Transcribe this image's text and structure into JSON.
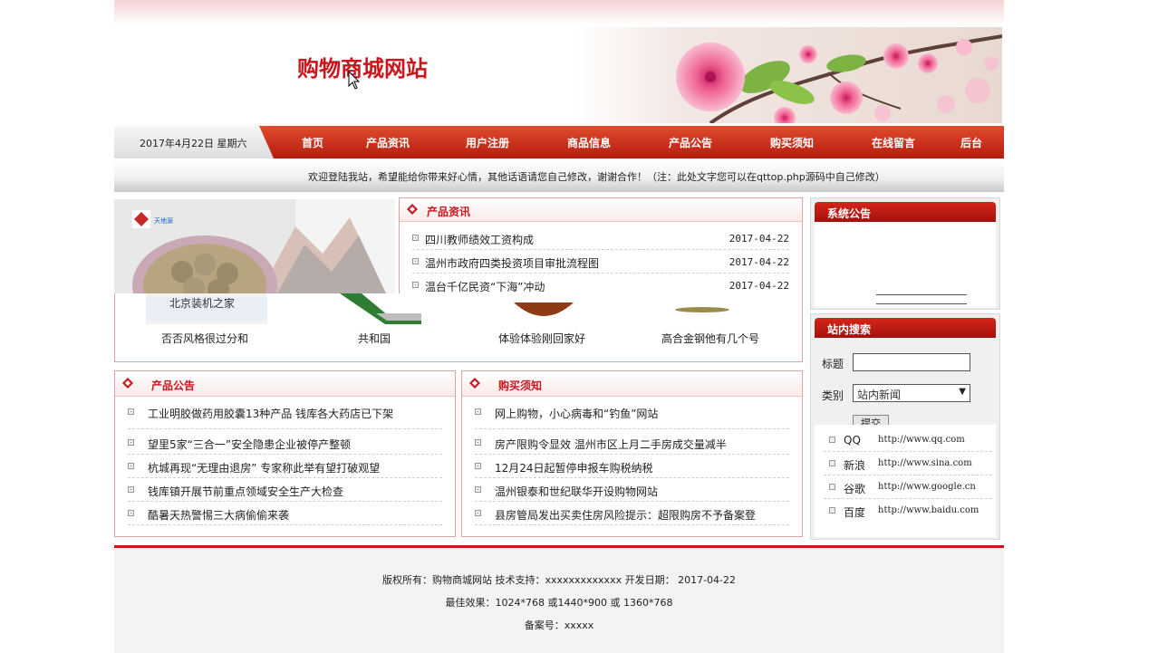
{
  "header": {
    "title": "购物商城网站"
  },
  "nav": {
    "date": "2017年4月22日  星期六",
    "items": [
      "首页",
      "产品资讯",
      "用户注册",
      "商品信息",
      "产品公告",
      "购买须知",
      "在线留言",
      "后台"
    ]
  },
  "welcome": "欢迎登陆我站，希望能给你带来好心情，其他话语请您自己修改，谢谢合作！（注：此处文字您可以在qttop.php源码中自己修改）",
  "product_news": {
    "title": "产品资讯",
    "items": [
      {
        "text": "四川教师绩效工资构成",
        "date": "2017-04-22"
      },
      {
        "text": "温州市政府四类投资项目审批流程图",
        "date": "2017-04-22"
      },
      {
        "text": "温台千亿民资“下海”冲动",
        "date": "2017-04-22"
      }
    ]
  },
  "thumbs": [
    "否否风格很过分和",
    "共和国",
    "体验体验刚回家好",
    "高合金钢他有几个号"
  ],
  "thumb_logo": "北京装机之家",
  "product_notice": {
    "title": "产品公告",
    "items": [
      "工业明胶做药用胶囊13种产品 钱库各大药店已下架",
      "望里5家“三合一”安全隐患企业被停产整顿",
      "杭城再现“无理由退房” 专家称此举有望打破观望",
      "钱库镇开展节前重点领域安全生产大检查",
      "酷暑天热警惕三大病偷偷来袭"
    ]
  },
  "purchase_notice": {
    "title": "购买须知",
    "items": [
      "网上购物，小心病毒和“钓鱼”网站",
      "房产限购令显效 温州市区上月二手房成交量减半",
      "12月24日起暂停申报车购税纳税",
      "温州银泰和世纪联华开设购物网站",
      "县房管局发出买卖住房风险提示：超限购房不予备案登"
    ]
  },
  "system_notice": {
    "title": "系统公告"
  },
  "search": {
    "title": "站内搜索",
    "title_label": "标题",
    "category_label": "类别",
    "category_value": "站内新闻",
    "submit_label": "提交"
  },
  "links": [
    {
      "name": "QQ",
      "url": "http://www.qq.com"
    },
    {
      "name": "新浪",
      "url": "http://www.sina.com"
    },
    {
      "name": "谷歌",
      "url": "http://www.google.cn"
    },
    {
      "name": "百度",
      "url": "http://www.baidu.com"
    }
  ],
  "footer": {
    "line1": "版权所有：购物商城网站  技术支持：xxxxxxxxxxxxx  开发日期： 2017-04-22",
    "line2": "最佳效果：1024*768 或1440*900 或 1360*768",
    "line3": "备案号：xxxxx"
  }
}
